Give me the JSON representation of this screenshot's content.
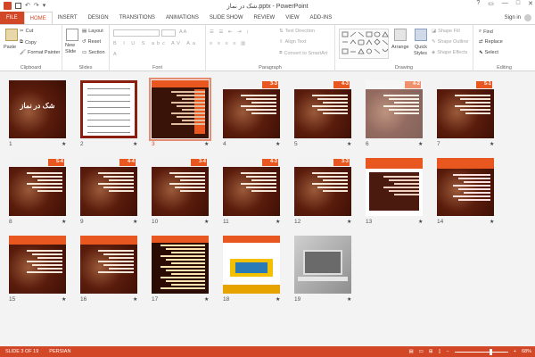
{
  "titlebar": {
    "title": "شک در نماز.pptx - PowerPoint",
    "controls": [
      "?",
      "▭",
      "—",
      "□",
      "✕"
    ]
  },
  "tabs": [
    {
      "label": "FILE",
      "kind": "file"
    },
    {
      "label": "HOME",
      "kind": "active"
    },
    {
      "label": "INSERT"
    },
    {
      "label": "DESIGN"
    },
    {
      "label": "TRANSITIONS"
    },
    {
      "label": "ANIMATIONS"
    },
    {
      "label": "SLIDE SHOW"
    },
    {
      "label": "REVIEW"
    },
    {
      "label": "VIEW"
    },
    {
      "label": "ADD-INS"
    }
  ],
  "signin": "Sign in",
  "ribbon": {
    "clipboard": {
      "label": "Clipboard",
      "paste": "Paste",
      "cut": "Cut",
      "copy": "Copy",
      "format_painter": "Format Painter"
    },
    "slides": {
      "label": "Slides",
      "new_slide": "New",
      "new_slide2": "Slide",
      "layout": "Layout",
      "reset": "Reset",
      "section": "Section"
    },
    "font": {
      "label": "Font"
    },
    "paragraph": {
      "label": "Paragraph",
      "text_direction": "Text Direction",
      "align_text": "Align Text",
      "convert": "Convert to SmartArt"
    },
    "drawing": {
      "label": "Drawing",
      "arrange": "Arrange",
      "quick_styles": "Quick",
      "quick_styles2": "Styles",
      "shape_fill": "Shape Fill",
      "shape_outline": "Shape Outline",
      "shape_effects": "Shape Effects"
    },
    "editing": {
      "label": "Editing",
      "find": "Find",
      "replace": "Replace",
      "select": "Select"
    }
  },
  "slides": [
    {
      "num": "1",
      "theme": "photo-title",
      "title": "شک در نماز"
    },
    {
      "num": "2",
      "theme": "table"
    },
    {
      "num": "3",
      "theme": "orange-list",
      "selected": true
    },
    {
      "num": "4",
      "theme": "dark-heading",
      "tag": "3-3"
    },
    {
      "num": "5",
      "theme": "dark-heading",
      "tag": "4-3"
    },
    {
      "num": "6",
      "theme": "dark-heading-faded",
      "tag": "4-2"
    },
    {
      "num": "7",
      "theme": "dark-heading",
      "tag": "5-1"
    },
    {
      "num": "8",
      "theme": "dark-heading",
      "tag": "5-4"
    },
    {
      "num": "9",
      "theme": "dark-heading",
      "tag": "4-4"
    },
    {
      "num": "10",
      "theme": "dark-heading",
      "tag": "3-4"
    },
    {
      "num": "11",
      "theme": "dark-heading",
      "tag": "4-3"
    },
    {
      "num": "12",
      "theme": "dark-heading",
      "tag": "3-3"
    },
    {
      "num": "13",
      "theme": "red-band"
    },
    {
      "num": "14",
      "theme": "red-band-text"
    },
    {
      "num": "15",
      "theme": "dark-plain"
    },
    {
      "num": "16",
      "theme": "dark-plain"
    },
    {
      "num": "17",
      "theme": "text-dense"
    },
    {
      "num": "18",
      "theme": "collage"
    },
    {
      "num": "19",
      "theme": "laptop"
    }
  ],
  "status": {
    "slide_info": "SLIDE 3 OF 19",
    "language": "PERSIAN",
    "zoom": "68%",
    "zoom_level": 0.68
  },
  "colors": {
    "accent": "#d24726",
    "slide_dark": "#6b1f0f",
    "slide_orange": "#e8571f"
  }
}
